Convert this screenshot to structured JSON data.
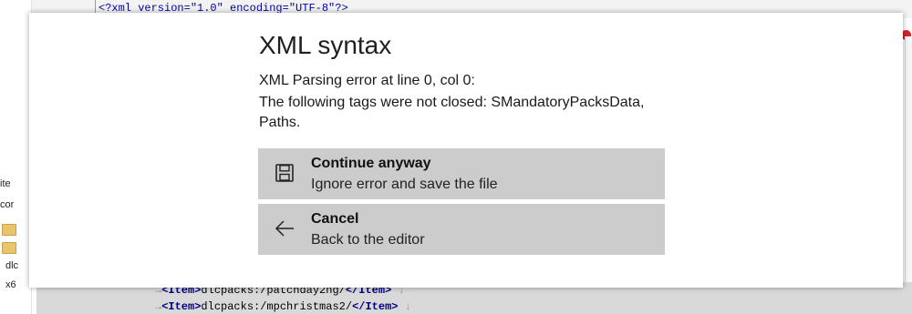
{
  "dialog": {
    "title": "XML syntax",
    "message_line1": "XML Parsing error at line 0, col 0:",
    "message_line2": "The following tags were not closed: SMandatoryPacksData,",
    "message_line3": "Paths.",
    "options": [
      {
        "title": "Continue anyway",
        "subtitle": "Ignore error and save the file",
        "icon": "save-icon"
      },
      {
        "title": "Cancel",
        "subtitle": "Back to the editor",
        "icon": "back-arrow-icon"
      }
    ]
  },
  "background": {
    "top_code": "<?xml version=\"1.0\" encoding=\"UTF-8\"?>",
    "left_labels": [
      "ite",
      "cor",
      "dlc",
      "x6"
    ],
    "code_lines": [
      {
        "open": "<Item>",
        "text": "dlcpacks:/patchday2ng/",
        "close": "</Item>"
      },
      {
        "open": "<Item>",
        "text": "dlcpacks:/mpchristmas2/",
        "close": "</Item>"
      }
    ]
  }
}
